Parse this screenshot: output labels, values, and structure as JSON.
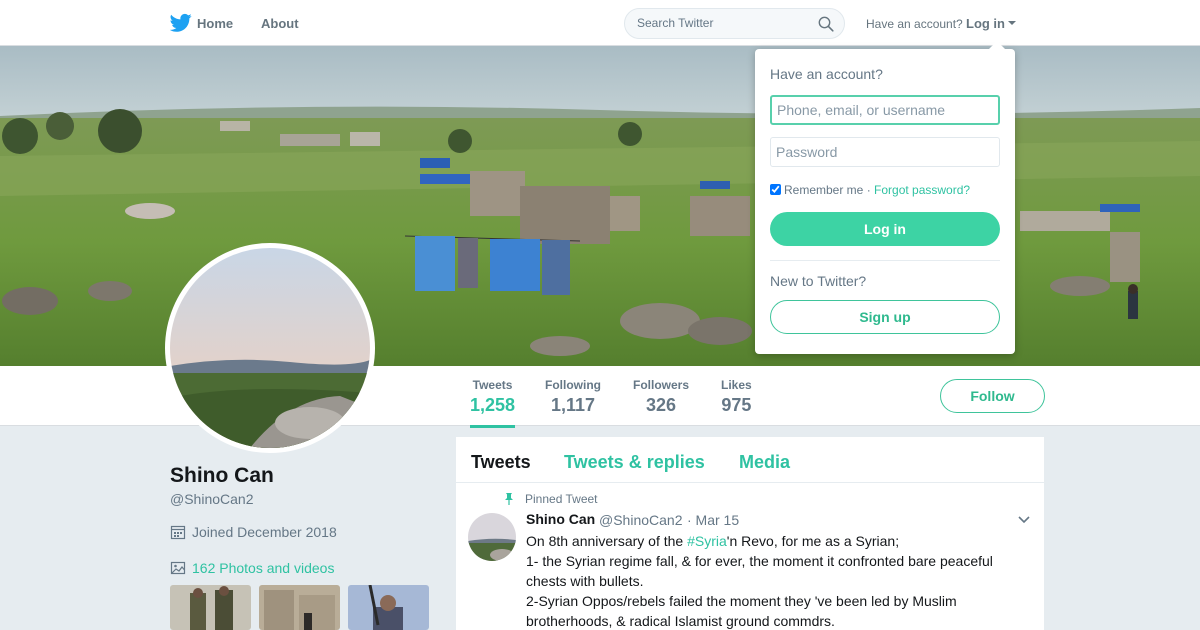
{
  "nav": {
    "home_label": "Home",
    "about_label": "About",
    "search_placeholder": "Search Twitter",
    "have_account": "Have an account?",
    "login_label": "Log in",
    "brand_color": "#1da1f2",
    "bird_icon": "twitter-bird-icon",
    "search_icon": "search-icon",
    "caret_icon": "caret-down-icon"
  },
  "profile": {
    "name": "Shino Can",
    "handle": "@ShinoCan2",
    "joined": "Joined December 2018",
    "photos_label": "162 Photos and videos",
    "follow_label": "Follow",
    "accent_color": "#2fc2a2"
  },
  "stats": [
    {
      "label": "Tweets",
      "value": "1,258",
      "active": true
    },
    {
      "label": "Following",
      "value": "1,117",
      "active": false
    },
    {
      "label": "Followers",
      "value": "326",
      "active": false
    },
    {
      "label": "Likes",
      "value": "975",
      "active": false
    }
  ],
  "timeline": {
    "tabs": [
      {
        "label": "Tweets",
        "active": true
      },
      {
        "label": "Tweets & replies",
        "active": false
      },
      {
        "label": "Media",
        "active": false
      }
    ],
    "pinned_label": "Pinned Tweet",
    "tweet": {
      "name": "Shino Can",
      "handle": "@ShinoCan2",
      "time": "· Mar 15",
      "line1_pre": "On 8th anniversary of the ",
      "line1_hashtag": "#Syria",
      "line1_post": "'n Revo, for me as a Syrian;",
      "line2": "1- the Syrian regime fall, & for ever, the moment it confronted bare peaceful chests with bullets.",
      "line3": "2-Syrian Oppos/rebels failed the moment they 've been led by Muslim brotherhoods, & radical Islamist ground commdrs."
    }
  },
  "login_dropdown": {
    "title": "Have an account?",
    "username_placeholder": "Phone, email, or username",
    "password_placeholder": "Password",
    "remember_label": "Remember me",
    "remember_checked": true,
    "separator": " · ",
    "forgot_label": "Forgot password?",
    "login_button": "Log in",
    "new_label": "New to Twitter?",
    "signup_button": "Sign up"
  }
}
